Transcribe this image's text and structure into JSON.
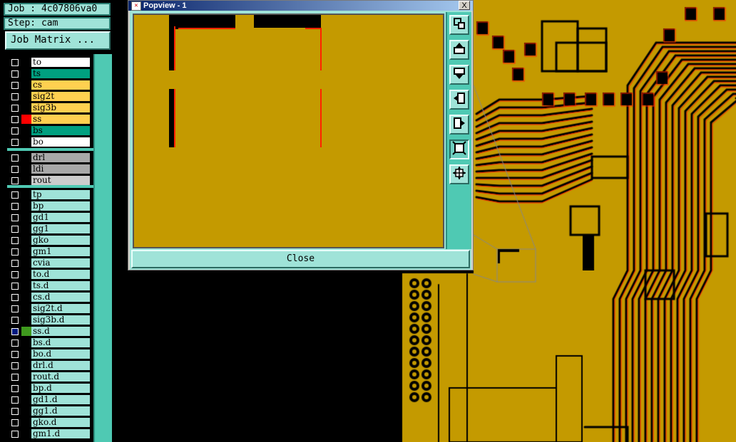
{
  "job_info": {
    "job_label": "Job : 4c07806va0",
    "step_label": "Step: cam"
  },
  "job_matrix_button": "Job Matrix ...",
  "layers": {
    "board_group": [
      {
        "name": "to",
        "color": "#ffffff",
        "swatch": ""
      },
      {
        "name": "ts",
        "color": "#00a080",
        "swatch": ""
      },
      {
        "name": "cs",
        "color": "#ffd050",
        "swatch": ""
      },
      {
        "name": "sig2t",
        "color": "#ffd050",
        "swatch": ""
      },
      {
        "name": "sig3b",
        "color": "#ffd050",
        "swatch": ""
      },
      {
        "name": "ss",
        "color": "#ffd050",
        "swatch": "#ff0000"
      },
      {
        "name": "bs",
        "color": "#00a080",
        "swatch": ""
      },
      {
        "name": "bo",
        "color": "#ffffff",
        "swatch": ""
      }
    ],
    "drill_group": [
      {
        "name": "drl",
        "color": "#a8a8a8",
        "swatch": ""
      },
      {
        "name": "ldi",
        "color": "#a8a8a8",
        "swatch": ""
      },
      {
        "name": "rout",
        "color": "#cccccc",
        "swatch": ""
      }
    ],
    "misc_group": [
      {
        "name": "tp",
        "color": "#9fe3d8",
        "swatch": ""
      },
      {
        "name": "bp",
        "color": "#9fe3d8",
        "swatch": ""
      },
      {
        "name": "gd1",
        "color": "#9fe3d8",
        "swatch": ""
      },
      {
        "name": "gg1",
        "color": "#9fe3d8",
        "swatch": ""
      },
      {
        "name": "gko",
        "color": "#9fe3d8",
        "swatch": ""
      },
      {
        "name": "gm1",
        "color": "#9fe3d8",
        "swatch": ""
      },
      {
        "name": "cvia",
        "color": "#9fe3d8",
        "swatch": ""
      },
      {
        "name": "to.d",
        "color": "#9fe3d8",
        "swatch": ""
      },
      {
        "name": "ts.d",
        "color": "#9fe3d8",
        "swatch": ""
      },
      {
        "name": "cs.d",
        "color": "#9fe3d8",
        "swatch": ""
      },
      {
        "name": "sig2t.d",
        "color": "#9fe3d8",
        "swatch": ""
      },
      {
        "name": "sig3b.d",
        "color": "#9fe3d8",
        "swatch": ""
      },
      {
        "name": "ss.d",
        "color": "#9fe3d8",
        "swatch": "#3f9a1e",
        "selected": true,
        "marker": "■"
      },
      {
        "name": "bs.d",
        "color": "#9fe3d8",
        "swatch": ""
      },
      {
        "name": "bo.d",
        "color": "#9fe3d8",
        "swatch": ""
      },
      {
        "name": "drl.d",
        "color": "#9fe3d8",
        "swatch": ""
      },
      {
        "name": "rout.d",
        "color": "#9fe3d8",
        "swatch": ""
      },
      {
        "name": "bp.d",
        "color": "#9fe3d8",
        "swatch": ""
      },
      {
        "name": "gd1.d",
        "color": "#9fe3d8",
        "swatch": ""
      },
      {
        "name": "gg1.d",
        "color": "#9fe3d8",
        "swatch": ""
      },
      {
        "name": "gko.d",
        "color": "#9fe3d8",
        "swatch": ""
      },
      {
        "name": "gm1.d",
        "color": "#9fe3d8",
        "swatch": ""
      }
    ]
  },
  "popview": {
    "title": "Popview - 1",
    "close_x": "X",
    "close_button": "Close",
    "tools": [
      {
        "icon": "zoom-home-icon"
      },
      {
        "icon": "pan-up-icon"
      },
      {
        "icon": "pan-down-icon"
      },
      {
        "icon": "pan-left-icon"
      },
      {
        "icon": "pan-right-icon"
      },
      {
        "icon": "zoom-fit-icon",
        "pressed": true
      },
      {
        "icon": "zoom-area-icon"
      }
    ]
  },
  "colors": {
    "copper": "#c49a00",
    "panel": "#9fe3d8",
    "panel_dark": "#4fc9b3",
    "trace_edge": "#ff2200"
  }
}
